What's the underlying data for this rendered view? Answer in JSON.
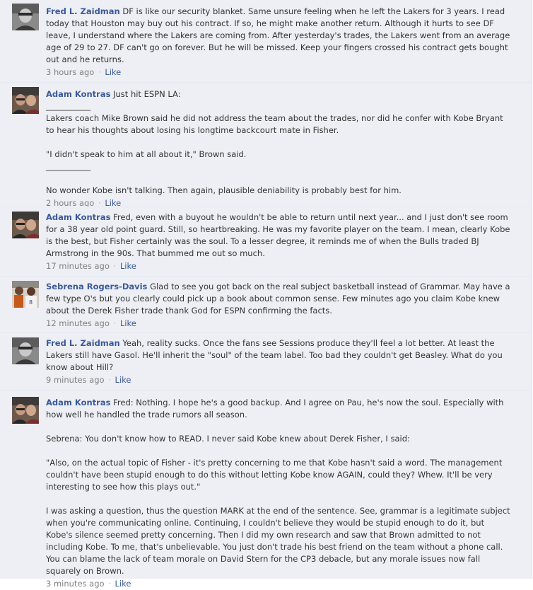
{
  "comments": [
    {
      "author": "Fred L. Zaidman",
      "text": "DF is like our security blanket. Same unsure feeling when he left the Lakers for 3 years. I read today that Houston may buy out his contract. If so, he might make another return. Although it hurts to see DF leave, I understand where the Lakers are coming from. After yesterday's trades, the Lakers went from an average age of 29 to 27. DF can't go on forever. But he will be missed. Keep your fingers crossed his contract gets bought out and he returns.",
      "time": "3 hours ago",
      "like": "Like"
    },
    {
      "author": "Adam Kontras",
      "text": "Just hit ESPN LA:\n___________\nLakers coach Mike Brown said he did not address the team about the trades, nor did he confer with Kobe Bryant to hear his thoughts about losing his longtime backcourt mate in Fisher.\n\n\"I didn't speak to him at all about it,\" Brown said.\n___________\n\nNo wonder Kobe isn't talking. Then again, plausible deniability is probably best for him.",
      "time": "2 hours ago",
      "like": "Like"
    },
    {
      "author": "Adam Kontras",
      "text": "Fred, even with a buyout he wouldn't be able to return until next year... and I just don't see room for a 38 year old point guard. Still, so heartbreaking. He was my favorite player on the team. I mean, clearly Kobe is the best, but Fisher certainly was the soul. To a lesser degree, it reminds me of when the Bulls traded BJ Armstrong in the 90s. That bummed me out so much.",
      "time": "17 minutes ago",
      "like": "Like"
    },
    {
      "author": "Sebrena Rogers-Davis",
      "text": "Glad to see you got back on the real subject basketball instead of Grammar. May have a few type O's but you clearly could pick up a book about common sense. Few minutes ago you claim Kobe knew about the Derek Fisher trade thank God for ESPN confirming the facts.",
      "time": "12 minutes ago",
      "like": "Like"
    },
    {
      "author": "Fred L. Zaidman",
      "text": "Yeah, reality sucks. Once the fans see Sessions produce they'll feel a lot better. At least the Lakers still have Gasol. He'll inherit the \"soul\" of the team label. Too bad they couldn't get Beasley. What do you know about Hill?",
      "time": "9 minutes ago",
      "like": "Like"
    },
    {
      "author": "Adam Kontras",
      "text": "Fred: Nothing. I hope he's a good backup. And I agree on Pau, he's now the soul. Especially with how well he handled the trade rumors all season.\n\nSebrena: You don't know how to READ. I never said Kobe knew about Derek Fisher, I said:\n\n\"Also, on the actual topic of Fisher - it's pretty concerning to me that Kobe hasn't said a word. The management couldn't have been stupid enough to do this without letting Kobe know AGAIN, could they? Whew. It'll be very interesting to see how this plays out.\"\n\nI was asking a question, thus the question MARK at the end of the sentence. See, grammar is a legitimate subject when you're communicating online. Continuing, I couldn't believe they would be stupid enough to do it, but Kobe's silence seemed pretty concerning. Then I did my own research and saw that Brown admitted to not including Kobe. To me, that's unbelievable. You just don't trade his best friend on the team without a phone call. You can blame the lack of team morale on David Stern for the CP3 debacle, but any morale issues now fall squarely on Brown.",
      "time": "3 minutes ago",
      "like": "Like"
    }
  ],
  "separator": "·",
  "colors": {
    "link": "#3b5998",
    "meta": "#808080",
    "background": "#edeff4"
  }
}
